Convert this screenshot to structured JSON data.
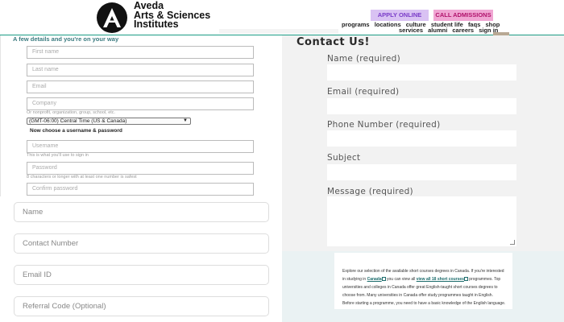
{
  "header": {
    "logo_line1": "Aveda",
    "logo_line2": "Arts & Sciences",
    "logo_line3": "Institutes",
    "apply_label": "APPLY ONLINE",
    "call_label": "CALL ADMISSIONS",
    "nav_row1": [
      "programs",
      "locations",
      "culture",
      "student life",
      "faqs",
      "shop"
    ],
    "nav_row2": [
      "services",
      "alumni",
      "careers",
      "sign in"
    ],
    "colors": {
      "apply_bg": "#d9c2f3",
      "call_bg": "#f0a6d3",
      "accent": "#1b9c85"
    }
  },
  "left_form": {
    "heading": "A few details and you're on your way",
    "first_name_placeholder": "First name",
    "last_name_placeholder": "Last name",
    "email_placeholder": "Email",
    "company_placeholder": "Company",
    "company_hint": "Or nonprofit, organization, group, school, etc.",
    "timezone_value": "(GMT-06:00) Central Time (US & Canada)",
    "subheading": "Now choose a username & password",
    "username_placeholder": "Username",
    "username_hint": "This is what you'll use to sign in",
    "password_placeholder": "Password",
    "password_hint": "8 characters or longer with at least one number is safest",
    "confirm_placeholder": "Confirm password"
  },
  "lead_form": {
    "name_placeholder": "Name",
    "contact_placeholder": "Contact Number",
    "email_placeholder": "Email ID",
    "referral_placeholder": "Referral Code (Optional)"
  },
  "contact": {
    "title": "Contact Us!",
    "name_label": "Name (required)",
    "email_label": "Email (required)",
    "phone_label": "Phone Number (required)",
    "subject_label": "Subject",
    "message_label": "Message (required)"
  },
  "info": {
    "text1": "Explore our selection of the available short courses degrees in Canada. If you're interested in studying in ",
    "link1": "Canada",
    "text2": " you can view all ",
    "link2": "view all 18 short courses",
    "text3": " programmes. Top universities and colleges in Canada offer great English-taught short courses degrees to choose from. Many universities in Canada offer study programmes taught in English. Before starting a programme, you need to have a basic knowledge of the English language."
  }
}
